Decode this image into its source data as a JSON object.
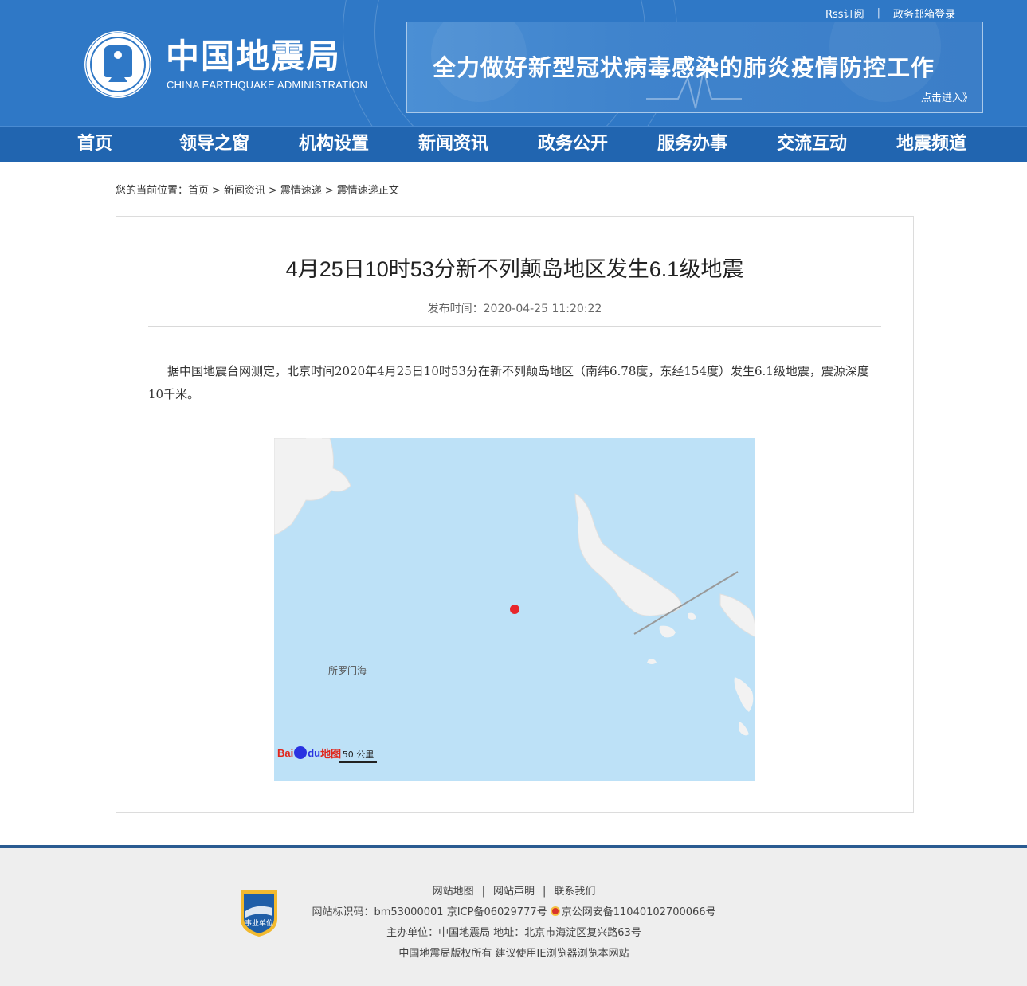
{
  "header": {
    "toplinks": {
      "rss": "Rss订阅",
      "sep": "|",
      "mail": "政务邮箱登录"
    },
    "logo_cn": "中国地震局",
    "logo_en": "CHINA EARTHQUAKE ADMINISTRATION",
    "banner_title": "全力做好新型冠状病毒感染的肺炎疫情防控工作",
    "banner_link": "点击进入》"
  },
  "nav": [
    "首页",
    "领导之窗",
    "机构设置",
    "新闻资讯",
    "政务公开",
    "服务办事",
    "交流互动",
    "地震频道"
  ],
  "breadcrumb": {
    "prefix": "您的当前位置：",
    "items": [
      "首页",
      "新闻资讯",
      "震情速递",
      "震情速递正文"
    ],
    "sep": ">"
  },
  "article": {
    "title": "4月25日10时53分新不列颠岛地区发生6.1级地震",
    "pubtime": "发布时间：2020-04-25 11:20:22",
    "body": "据中国地震台网测定，北京时间2020年4月25日10时53分在新不列颠岛地区（南纬6.78度，东经154度）发生6.1级地震，震源深度10千米。"
  },
  "map": {
    "sea_label": "所罗门海",
    "logo_part1": "Bai",
    "logo_part2": "du",
    "logo_part3": "地图",
    "scale": "50 公里",
    "colors": {
      "sea": "#bde1f7",
      "land": "#f0f0f0",
      "epicenter": "#e8262b"
    }
  },
  "footer": {
    "links": [
      "网站地图",
      "网站声明",
      "联系我们"
    ],
    "sep": "|",
    "line2_a": "网站标识码：bm53000001",
    "line2_b": "京ICP备06029777号",
    "line2_c": "京公网安备11040102700066号",
    "line3": "主办单位：中国地震局  地址：北京市海淀区复兴路63号",
    "line4": "中国地震局版权所有  建议使用IE浏览器浏览本网站",
    "badge_text": "事业单位"
  }
}
